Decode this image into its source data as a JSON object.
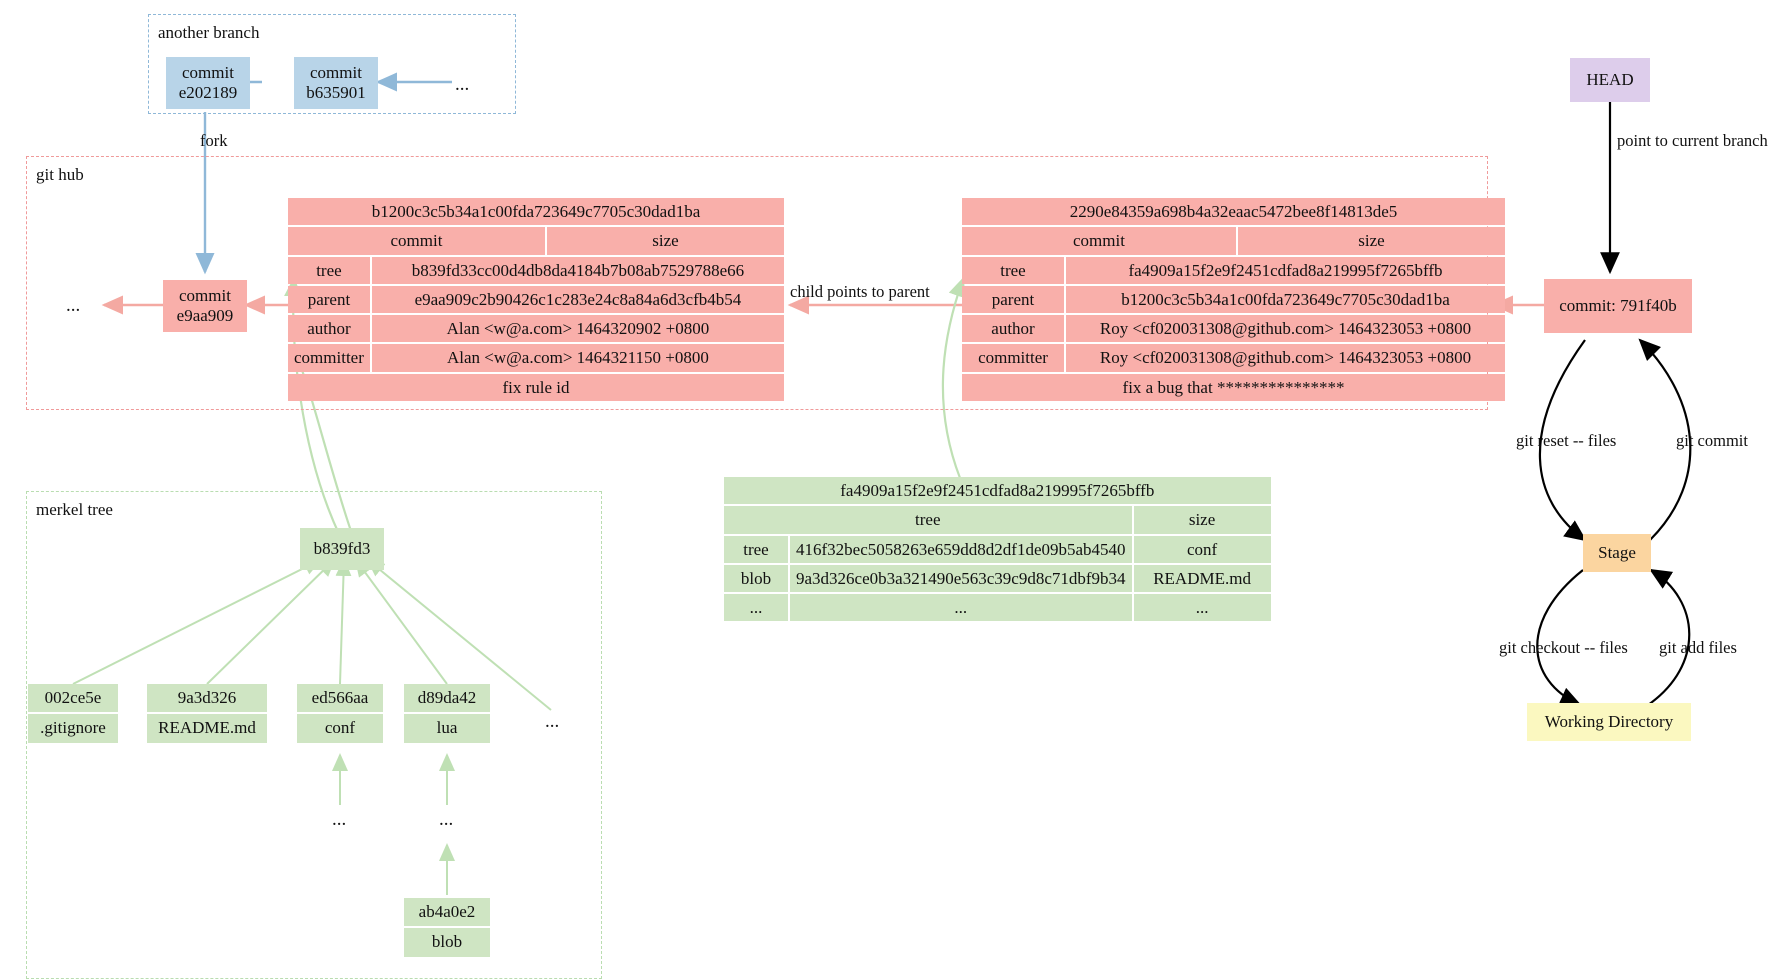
{
  "groups": {
    "another_branch": "another branch",
    "git_hub": "git hub",
    "merkel_tree": "merkel tree"
  },
  "branch_boxes": {
    "commit_e202189": "commit\ne202189",
    "commit_b635901": "commit\nb635901",
    "ellipsis_right": "...",
    "fork_label": "fork"
  },
  "githubsection": {
    "commit_e9aa909": "commit\ne9aa909",
    "ellipsis_left": "...",
    "child_points_to_parent": "child points to parent"
  },
  "commit_table_1": {
    "hash": "b1200c3c5b34a1c00fda723649c7705c30dad1ba",
    "col_left": "commit",
    "col_right": "size",
    "rows": [
      {
        "key": "tree",
        "value": "b839fd33cc00d4db8da4184b7b08ab7529788e66"
      },
      {
        "key": "parent",
        "value": "e9aa909c2b90426c1c283e24c8a84a6d3cfb4b54"
      },
      {
        "key": "author",
        "value": "Alan <w@a.com> 1464320902 +0800"
      },
      {
        "key": "committer",
        "value": "Alan <w@a.com> 1464321150 +0800"
      }
    ],
    "message": "fix rule id"
  },
  "commit_table_2": {
    "hash": "2290e84359a698b4a32eaac5472bee8f14813de5",
    "col_left": "commit",
    "col_right": "size",
    "rows": [
      {
        "key": "tree",
        "value": "fa4909a15f2e9f2451cdfad8a219995f7265bffb"
      },
      {
        "key": "parent",
        "value": "b1200c3c5b34a1c00fda723649c7705c30dad1ba"
      },
      {
        "key": "author",
        "value": "Roy <cf020031308@github.com> 1464323053 +0800"
      },
      {
        "key": "committer",
        "value": "Roy <cf020031308@github.com> 1464323053 +0800"
      }
    ],
    "message": "fix a bug that ***************"
  },
  "tree_table": {
    "hash": "fa4909a15f2e9f2451cdfad8a219995f7265bffb",
    "col_left": "tree",
    "col_right": "size",
    "rows": [
      {
        "type": "tree",
        "hash": "416f32bec5058263e659dd8d2df1de09b5ab4540",
        "name": "conf"
      },
      {
        "type": "blob",
        "hash": "9a3d326ce0b3a321490e563c39c9d8c71dbf9b34",
        "name": "README.md"
      },
      {
        "type": "...",
        "hash": "...",
        "name": "..."
      }
    ]
  },
  "merkel": {
    "root": "b839fd3",
    "leaves": [
      {
        "hash": "002ce5e",
        "name": ".gitignore"
      },
      {
        "hash": "9a3d326",
        "name": "README.md"
      },
      {
        "hash": "ed566aa",
        "name": "conf"
      },
      {
        "hash": "d89da42",
        "name": "lua"
      }
    ],
    "leaf_ellipsis": "...",
    "conf_child_ellipsis": "...",
    "lua_child_ellipsis": "...",
    "blob_node": {
      "hash": "ab4a0e2",
      "name": "blob"
    }
  },
  "right_flow": {
    "head": "HEAD",
    "head_edge_label": "point to current branch",
    "current_commit": "commit: 791f40b",
    "stage": "Stage",
    "working_directory": "Working Directory",
    "git_reset": "git reset -- files",
    "git_commit": "git commit",
    "git_checkout": "git checkout -- files",
    "git_add": "git add files"
  },
  "colors": {
    "blue_box": "#b8d4e8",
    "red_box": "#f9afaa",
    "green_box": "#cfe5c3",
    "purple_box": "#ddcdeb",
    "orange_box": "#fbd5a0",
    "yellow_box": "#fbf8c0",
    "blue_dash": "#8fb8d8",
    "red_dash": "#f09a9a",
    "green_dash": "#b9ddb0",
    "black_edge": "#000000"
  }
}
